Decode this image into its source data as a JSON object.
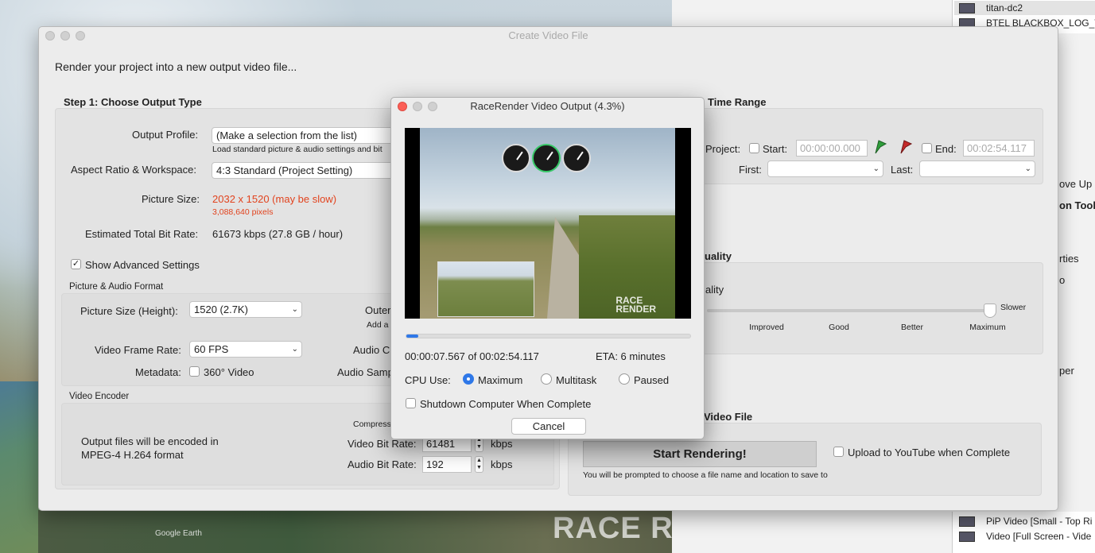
{
  "background": {
    "watermark": "RACE RENDER",
    "google_credit": "Google Earth",
    "list_top": [
      "titan-dc2",
      "BTEL BLACKBOX_LOG_T"
    ],
    "list_bottom": [
      "PiP Video [Small - Top Ri",
      "Video [Full Screen - Vide"
    ],
    "right_fragments": [
      "ove Up",
      "on Tool",
      "rties",
      "o",
      "per"
    ]
  },
  "dialog": {
    "title": "Create Video File",
    "intro": "Render your project into a new output video file...",
    "step1": {
      "title": "Step 1: Choose Output Type",
      "output_profile_label": "Output Profile:",
      "output_profile_value": "(Make a selection from the list)",
      "output_profile_hint": "Load standard picture & audio settings and bit",
      "aspect_label": "Aspect Ratio & Workspace:",
      "aspect_value": "4:3 Standard (Project Setting)",
      "picture_size_label": "Picture Size:",
      "picture_size_value": "2032 x 1520 (may be slow)",
      "picture_pixels": "3,088,640 pixels",
      "bitrate_label": "Estimated Total Bit Rate:",
      "bitrate_value": "61673 kbps  (27.8 GB / hour)",
      "advanced_label": "Show Advanced Settings",
      "advanced_checked": true,
      "format_section": "Picture & Audio Format",
      "height_label": "Picture Size (Height):",
      "height_value": "1520 (2.7K)",
      "outer_label": "Outer",
      "outer_hint": "Add a b",
      "fps_label": "Video Frame Rate:",
      "fps_value": "60 FPS",
      "audio_ch_label": "Audio Ch",
      "metadata_label": "Metadata:",
      "vr_label": "360° Video",
      "audio_samp_label": "Audio Samp",
      "encoder_section": "Video Encoder",
      "encoder_text_1": "Output files will be encoded in",
      "encoder_text_2": "MPEG-4 H.264 format",
      "compression_label": "Compressio",
      "video_bitrate_label": "Video Bit Rate:",
      "video_bitrate_value": "61481",
      "audio_bitrate_label": "Audio Bit Rate:",
      "audio_bitrate_value": "192",
      "kbps": "kbps"
    },
    "time_range": {
      "title": "Time Range",
      "project_label": "Project:",
      "start_label": "Start:",
      "start_value": "00:00:00.000",
      "end_label": "End:",
      "end_value": "00:02:54.117",
      "first_label": "First:",
      "last_label": "Last:",
      "start_flag_color": "#2f9d3a",
      "end_flag_color": "#c42a2a"
    },
    "quality": {
      "title": "uality",
      "label": "ality",
      "slower": "Slower",
      "ticks": [
        "Improved",
        "Good",
        "Better",
        "Maximum"
      ],
      "level": 1.0
    },
    "video_file": {
      "title": "Video File",
      "start_button": "Start Rendering!",
      "youtube_label": "Upload to YouTube when Complete",
      "hint": "You will be prompted to choose a file name and location to save to"
    }
  },
  "render_window": {
    "title": "RaceRender Video Output (4.3%)",
    "progress": 0.043,
    "time_text": "00:00:07.567 of 00:02:54.117",
    "eta_text": "ETA: 6 minutes",
    "cpu_label": "CPU Use:",
    "cpu_options": [
      "Maximum",
      "Multitask",
      "Paused"
    ],
    "cpu_selected": "Maximum",
    "shutdown_label": "Shutdown Computer When Complete",
    "cancel_label": "Cancel",
    "video_logo_1": "RACE",
    "video_logo_2": "RENDER"
  }
}
